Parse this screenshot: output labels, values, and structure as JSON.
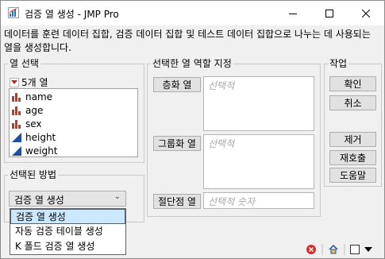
{
  "window": {
    "title": "검증 열 생성 - JMP Pro",
    "description": "데이터를 훈련 데이터 집합, 검증 데이터 집합 및 테스트 데이터 집합으로 나누는 데 사용되는 열을 생성합니다."
  },
  "column_select": {
    "legend": "열 선택",
    "count_label": "5개 열",
    "columns": [
      {
        "name": "name",
        "icon": "nominal-bar-icon",
        "color": "#c0392b"
      },
      {
        "name": "age",
        "icon": "nominal-bar-icon",
        "color": "#c0392b"
      },
      {
        "name": "sex",
        "icon": "nominal-bar-icon",
        "color": "#c0392b"
      },
      {
        "name": "height",
        "icon": "continuous-ramp-icon",
        "color": "#1f4fa3"
      },
      {
        "name": "weight",
        "icon": "continuous-ramp-icon",
        "color": "#1f4fa3"
      }
    ]
  },
  "roles": {
    "legend": "선택한 열 역할 지정",
    "stratify_label": "층화 열",
    "stratify_placeholder": "선택적",
    "group_label": "그룹화 열",
    "group_placeholder": "선택적",
    "cutpoint_label": "절단점 열",
    "cutpoint_placeholder": "선택적 숫자"
  },
  "actions": {
    "legend": "작업",
    "ok": "확인",
    "cancel": "취소",
    "remove": "제거",
    "recall": "재호출",
    "help": "도움말"
  },
  "method": {
    "legend": "선택된 방법",
    "selected": "검증 열 생성",
    "options": [
      "검증 열 생성",
      "자동 검증 테이블 생성",
      "K 폴드 검증 열 생성"
    ]
  },
  "colors": {
    "selection_fill": "#cce8ff",
    "selection_border": "#0078d7",
    "jmp_logo": "#2a6fb5"
  }
}
